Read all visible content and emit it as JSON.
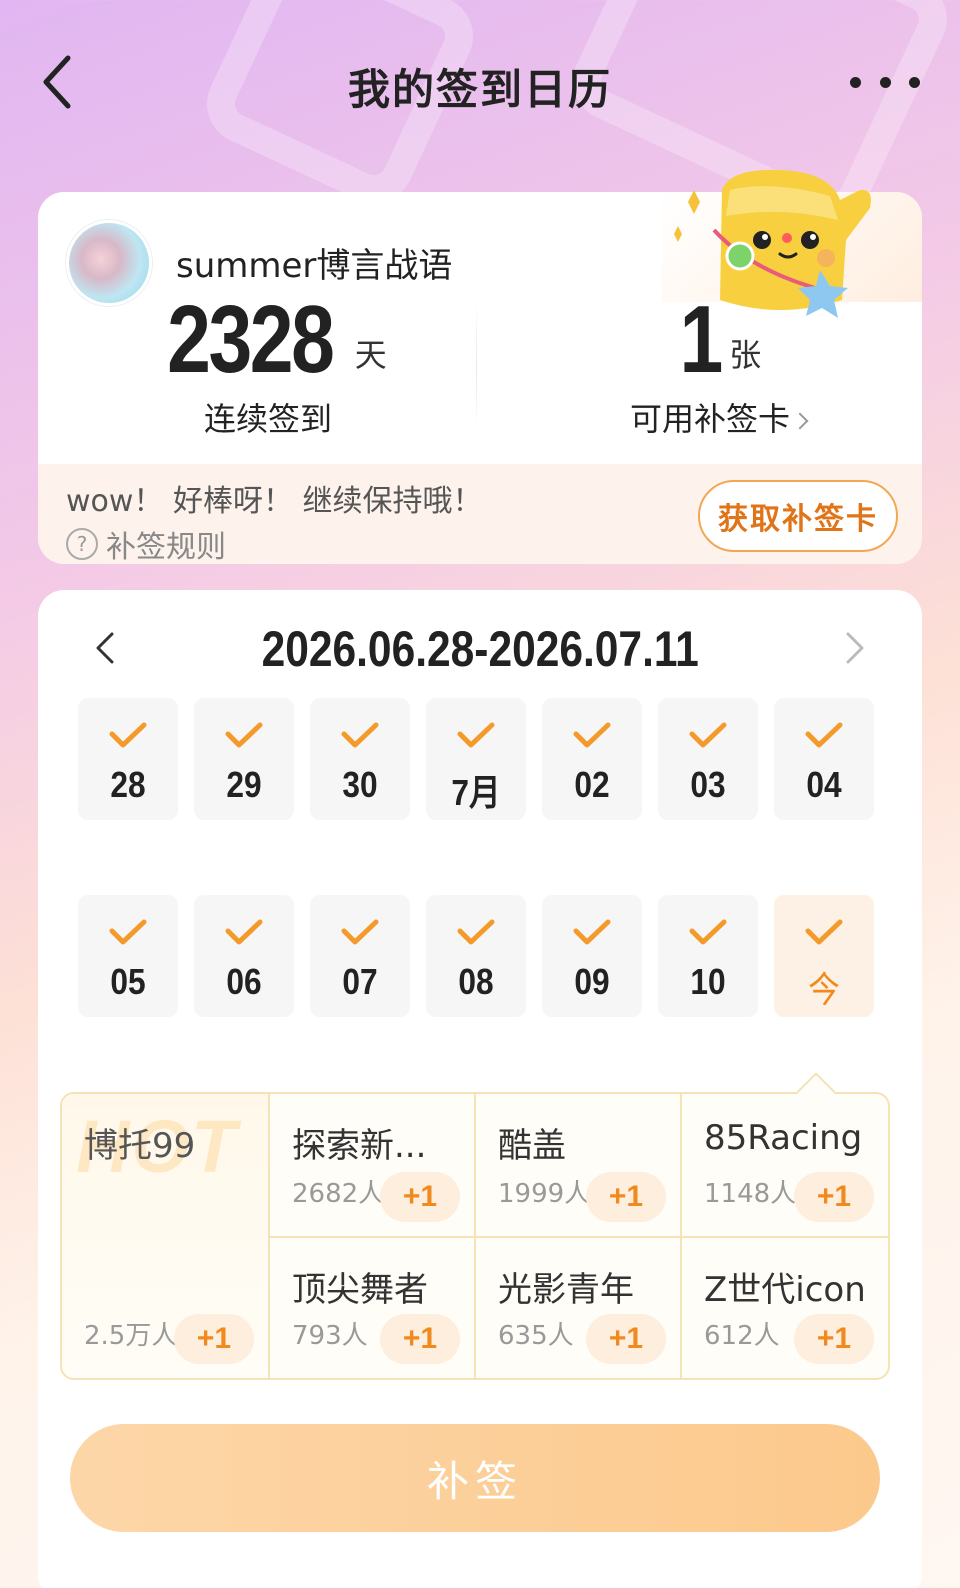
{
  "header": {
    "title": "我的签到日历"
  },
  "profile": {
    "username": "summer博言战语",
    "streak_days": "2328",
    "streak_unit": "天",
    "streak_label": "连续签到",
    "makeup_cards": "1",
    "makeup_unit": "张",
    "makeup_label": "可用补签卡",
    "encourage": "wow！ 好棒呀！ 继续保持哦！",
    "rules_icon": "?",
    "rules_label": "补签规则",
    "get_card_label": "获取补签卡"
  },
  "calendar": {
    "range": "2026.06.28-2026.07.11",
    "week1": [
      {
        "label": "28",
        "checked": true
      },
      {
        "label": "29",
        "checked": true
      },
      {
        "label": "30",
        "checked": true
      },
      {
        "label": "7月",
        "checked": true
      },
      {
        "label": "02",
        "checked": true
      },
      {
        "label": "03",
        "checked": true
      },
      {
        "label": "04",
        "checked": true
      }
    ],
    "week2": [
      {
        "label": "05",
        "checked": true
      },
      {
        "label": "06",
        "checked": true
      },
      {
        "label": "07",
        "checked": true
      },
      {
        "label": "08",
        "checked": true
      },
      {
        "label": "09",
        "checked": true
      },
      {
        "label": "10",
        "checked": true
      },
      {
        "label": "今",
        "checked": true,
        "today": true
      }
    ]
  },
  "topics": {
    "hot_watermark": "HOT",
    "hot": {
      "name": "博托99",
      "count": "2.5万人",
      "plus": "+1"
    },
    "items": [
      {
        "name": "探索新...",
        "count": "2682人",
        "plus": "+1"
      },
      {
        "name": "酷盖",
        "count": "1999人",
        "plus": "+1"
      },
      {
        "name": "85Racing",
        "count": "1148人",
        "plus": "+1"
      },
      {
        "name": "顶尖舞者",
        "count": "793人",
        "plus": "+1"
      },
      {
        "name": "光影青年",
        "count": "635人",
        "plus": "+1"
      },
      {
        "name": "Z世代icon",
        "count": "612人",
        "plus": "+1"
      }
    ]
  },
  "makeup_button": "补签",
  "colors": {
    "accent": "#f08a1e",
    "check": "#f39a2a",
    "button": "#fcc98c"
  }
}
